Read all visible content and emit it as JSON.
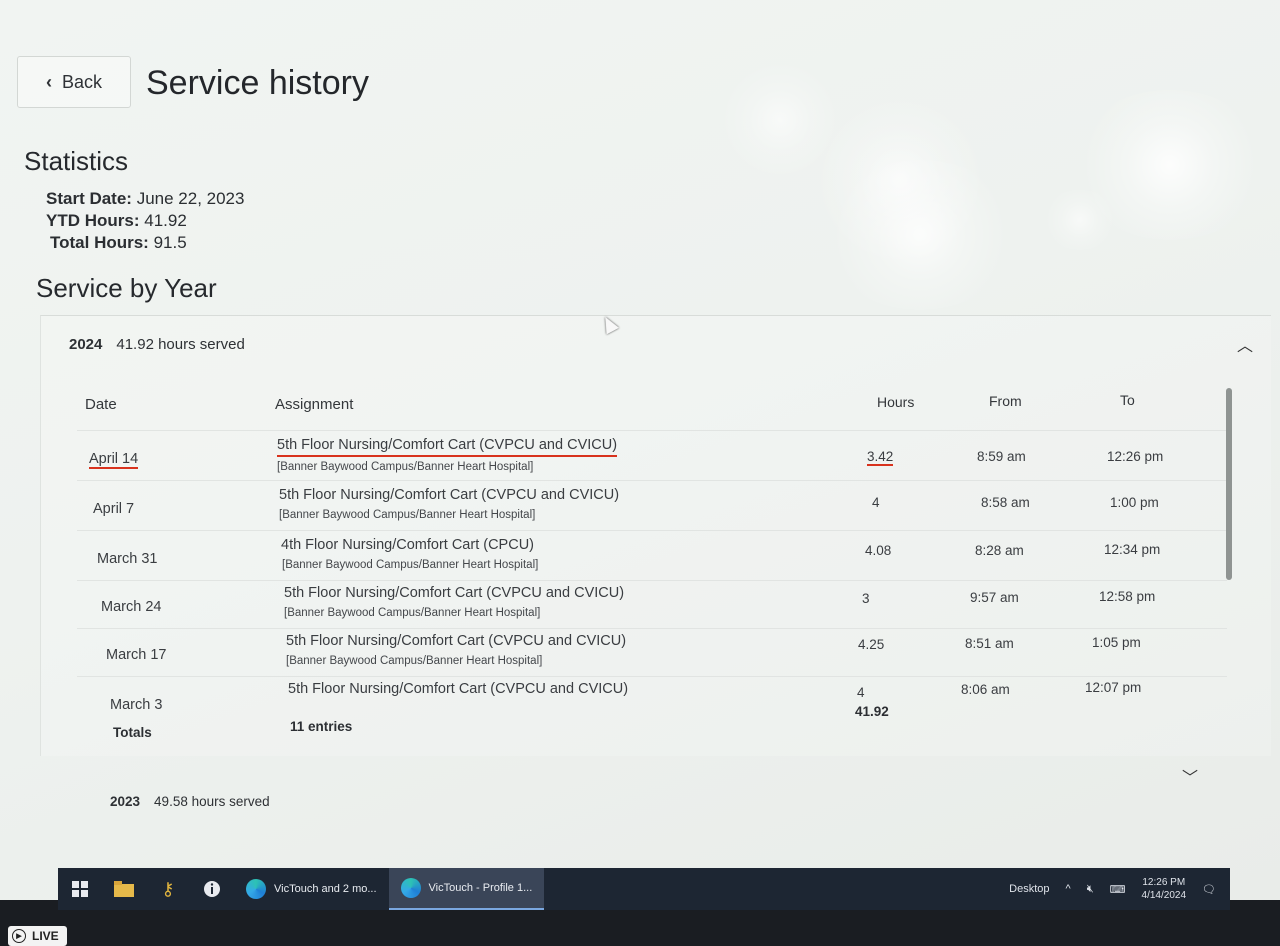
{
  "header": {
    "back_label": "Back",
    "title": "Service history"
  },
  "statistics": {
    "heading": "Statistics",
    "start_date_label": "Start Date:",
    "start_date": "June 22, 2023",
    "ytd_label": "YTD Hours:",
    "ytd_hours": "41.92",
    "total_label": "Total Hours:",
    "total_hours": "91.5"
  },
  "service_by_year": {
    "heading": "Service by Year",
    "year_2024": {
      "year": "2024",
      "summary": "41.92 hours served",
      "columns": {
        "date": "Date",
        "assignment": "Assignment",
        "hours": "Hours",
        "from": "From",
        "to": "To"
      },
      "rows": [
        {
          "date": "April 14",
          "assignment": "5th Floor Nursing/Comfort Cart (CVPCU and CVICU)",
          "location": "[Banner Baywood Campus/Banner Heart Hospital]",
          "hours": "3.42",
          "from": "8:59 am",
          "to": "12:26 pm"
        },
        {
          "date": "April 7",
          "assignment": "5th Floor Nursing/Comfort Cart (CVPCU and CVICU)",
          "location": "[Banner Baywood Campus/Banner Heart Hospital]",
          "hours": "4",
          "from": "8:58 am",
          "to": "1:00 pm"
        },
        {
          "date": "March 31",
          "assignment": "4th Floor Nursing/Comfort Cart (CPCU)",
          "location": "[Banner Baywood Campus/Banner Heart Hospital]",
          "hours": "4.08",
          "from": "8:28 am",
          "to": "12:34 pm"
        },
        {
          "date": "March 24",
          "assignment": "5th Floor Nursing/Comfort Cart (CVPCU and CVICU)",
          "location": "[Banner Baywood Campus/Banner Heart Hospital]",
          "hours": "3",
          "from": "9:57 am",
          "to": "12:58 pm"
        },
        {
          "date": "March 17",
          "assignment": "5th Floor Nursing/Comfort Cart (CVPCU and CVICU)",
          "location": "[Banner Baywood Campus/Banner Heart Hospital]",
          "hours": "4.25",
          "from": "8:51 am",
          "to": "1:05 pm"
        },
        {
          "date": "March 3",
          "assignment": "5th Floor Nursing/Comfort Cart (CVPCU and CVICU)",
          "location": "",
          "hours": "4",
          "from": "8:06 am",
          "to": "12:07 pm"
        }
      ],
      "totals": {
        "label": "Totals",
        "entries": "11 entries",
        "hours": "41.92"
      }
    },
    "year_2023": {
      "year": "2023",
      "summary": "49.58 hours served"
    }
  },
  "taskbar": {
    "apps": [
      {
        "label": "VicTouch and 2 mo..."
      },
      {
        "label": "VicTouch - Profile 1..."
      }
    ],
    "desktop_label": "Desktop",
    "time": "12:26 PM",
    "date": "4/14/2024"
  },
  "badge": {
    "label": "LIVE"
  }
}
